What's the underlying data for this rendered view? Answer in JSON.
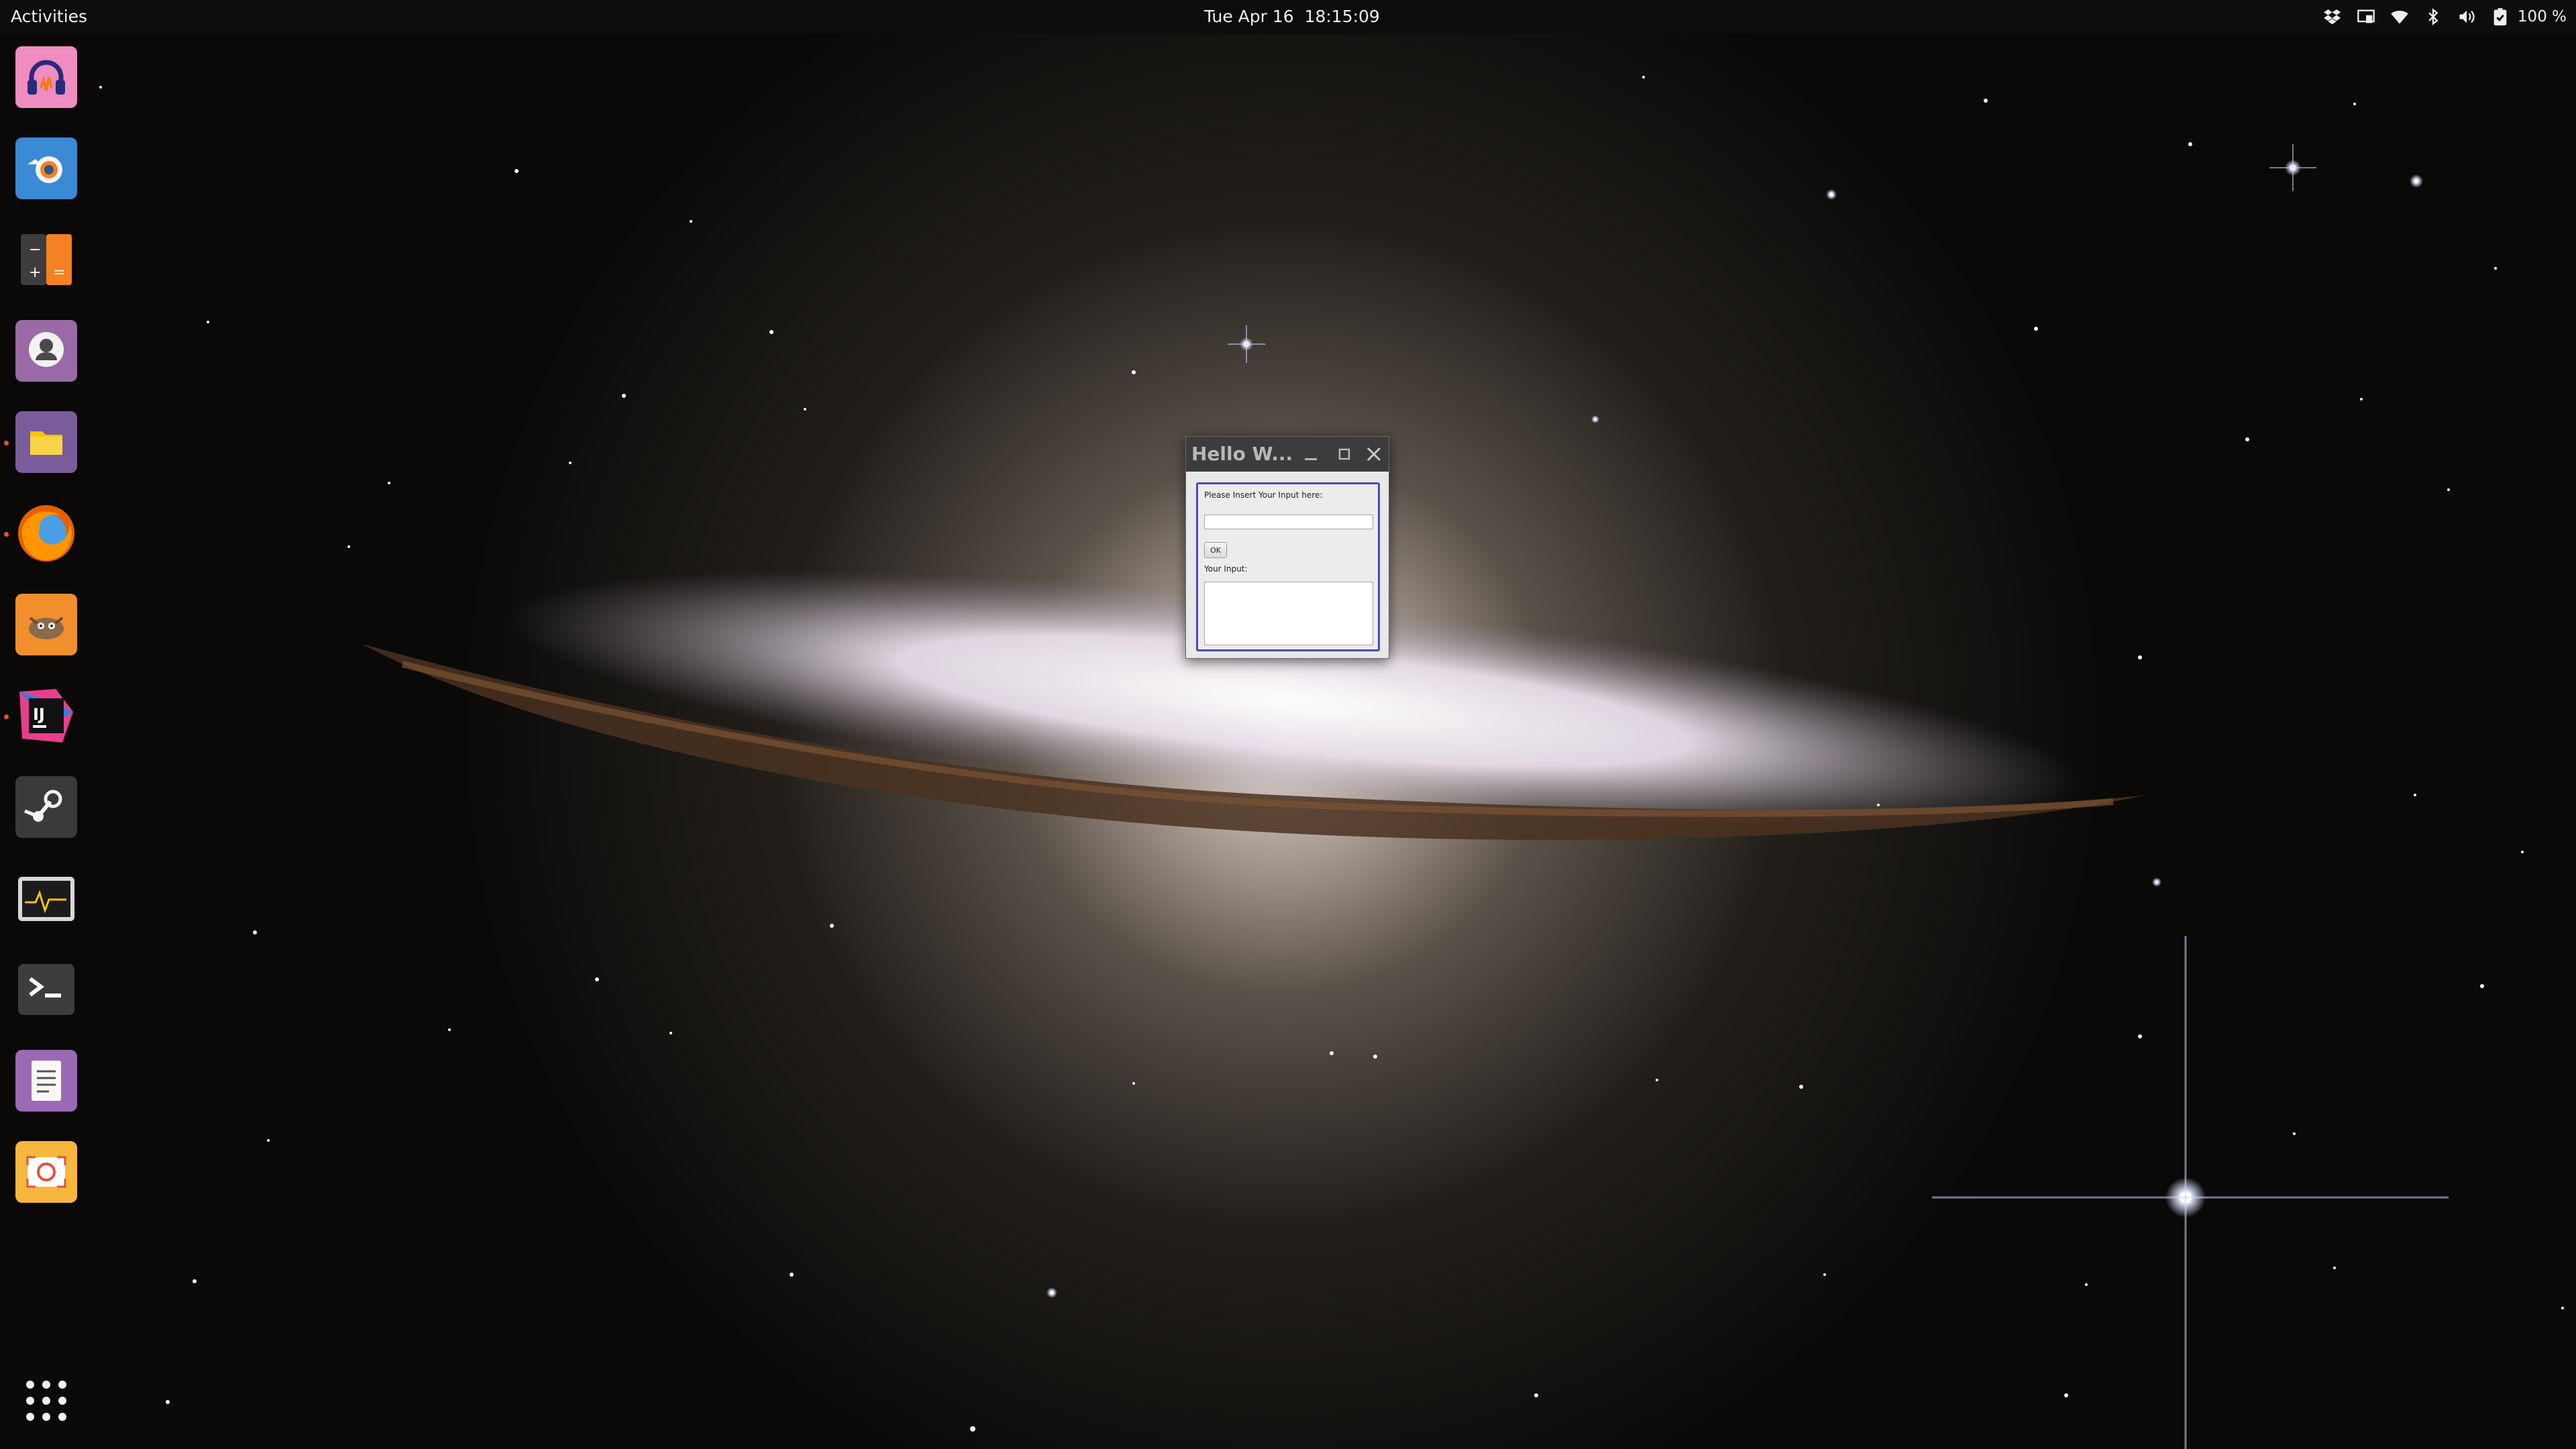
{
  "topbar": {
    "activities_label": "Activities",
    "clock": "Tue Apr 16  18:15:09",
    "tray_icons": [
      "dropbox-icon",
      "screen-share-icon",
      "wifi-icon",
      "bluetooth-icon",
      "volume-icon",
      "battery-icon"
    ],
    "battery_percent": "100 %"
  },
  "dock": {
    "items": [
      {
        "name": "audacity",
        "icon": "headphones-icon",
        "running": false
      },
      {
        "name": "blender",
        "icon": "blender-icon",
        "running": false
      },
      {
        "name": "calculator",
        "icon": "calculator-icon",
        "running": false
      },
      {
        "name": "cheese",
        "icon": "webcam-icon",
        "running": false
      },
      {
        "name": "files",
        "icon": "folder-icon",
        "running": true
      },
      {
        "name": "firefox",
        "icon": "firefox-icon",
        "running": true
      },
      {
        "name": "gimp",
        "icon": "gimp-icon",
        "running": false
      },
      {
        "name": "intellij",
        "icon": "intellij-icon",
        "running": true
      },
      {
        "name": "steam",
        "icon": "steam-icon",
        "running": false
      },
      {
        "name": "system-monitor",
        "icon": "system-monitor-icon",
        "running": false
      },
      {
        "name": "terminal",
        "icon": "terminal-icon",
        "running": false
      },
      {
        "name": "text-editor",
        "icon": "text-editor-icon",
        "running": false
      },
      {
        "name": "screenshot",
        "icon": "screenshot-icon",
        "running": false
      }
    ],
    "app_grid_icon": "app-grid-icon"
  },
  "dialog": {
    "title": "Hello W...",
    "prompt_label": "Please Insert Your Input here:",
    "input_value": "",
    "ok_label": "OK",
    "output_label": "Your Input:",
    "output_value": ""
  },
  "colors": {
    "topbar_bg": "#0d0d0d",
    "running_indicator": "#e95420",
    "dialog_focus_border": "#4a4ab8",
    "dialog_titlebar": "#3c3c3c"
  }
}
